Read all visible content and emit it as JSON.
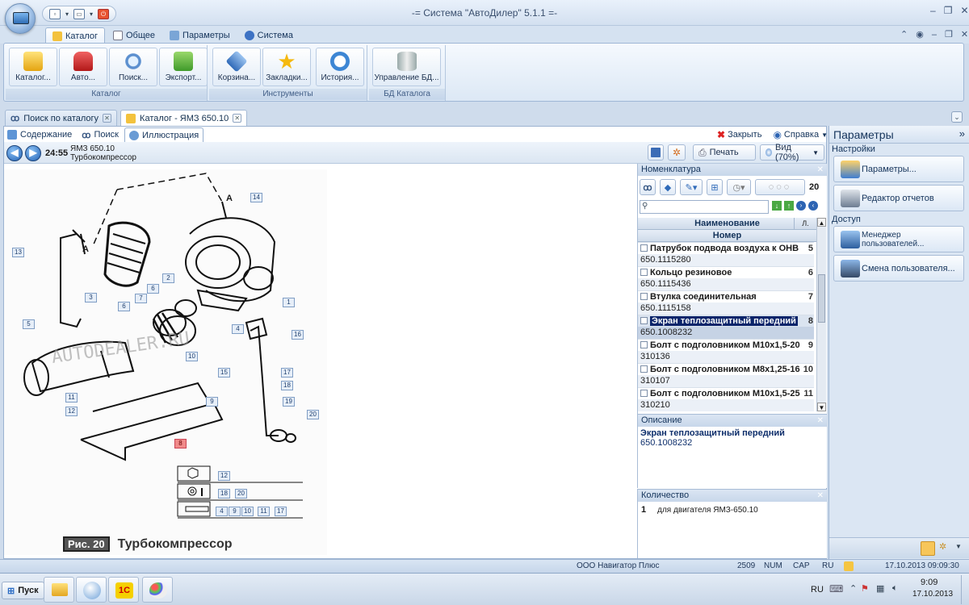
{
  "window": {
    "title": "-= Система \"АвтоДилер\" 5.1.1 =-"
  },
  "ribbon_tabs": [
    {
      "label": "Каталог",
      "active": true
    },
    {
      "label": "Общее",
      "active": false
    },
    {
      "label": "Параметры",
      "active": false
    },
    {
      "label": "Система",
      "active": false
    }
  ],
  "ribbon": {
    "groups": [
      {
        "label": "Каталог",
        "buttons": [
          "Каталог...",
          "Авто...",
          "Поиск...",
          "Экспорт..."
        ]
      },
      {
        "label": "Инструменты",
        "buttons": [
          "Корзина...",
          "Закладки...",
          "История..."
        ]
      },
      {
        "label": "БД Каталога",
        "buttons": [
          "Управление БД..."
        ]
      }
    ]
  },
  "doc_tabs": [
    {
      "label": "Поиск по каталогу",
      "active": false
    },
    {
      "label": "Каталог - ЯМЗ  650.10",
      "active": true
    }
  ],
  "sub_tabs": [
    {
      "label": "Содержание",
      "active": false
    },
    {
      "label": "Поиск",
      "active": false
    },
    {
      "label": "Иллюстрация",
      "active": true
    }
  ],
  "toolbar": {
    "close_label": "Закрыть",
    "help_label": "Справка",
    "time": "24:55",
    "model": "ЯМЗ  650.10",
    "subtitle": "Турбокомпрессор",
    "print_label": "Печать",
    "view_label": "Вид (70%)"
  },
  "illustration": {
    "watermark": "AUTODEALER.RU",
    "caption_prefix": "Рис. 20",
    "caption": "Турбокомпрессор",
    "callouts": [
      "14",
      "A",
      "13",
      "A",
      "3",
      "2",
      "6",
      "6",
      "7",
      "1",
      "5",
      "4",
      "16",
      "10",
      "15",
      "17",
      "18",
      "11",
      "12",
      "9",
      "19",
      "20",
      "8"
    ],
    "legend": {
      "row1": [
        "12"
      ],
      "row2": [
        "18",
        "20"
      ],
      "row3": [
        "4",
        "9",
        "10",
        "11",
        "17"
      ]
    }
  },
  "nomenclature": {
    "title": "Номенклатура",
    "toolbar_extra": "20",
    "search_placeholder": "",
    "col_name": "Наименование",
    "col_num": "Номер",
    "col_qty": "Л.",
    "rows": [
      {
        "name": "Патрубок подвода воздуха к ОНВ",
        "number": "650.1115280",
        "qty": "5",
        "selected": false
      },
      {
        "name": "Кольцо резиновое",
        "number": "650.1115436",
        "qty": "6",
        "selected": false
      },
      {
        "name": "Втулка соединительная",
        "number": "650.1115158",
        "qty": "7",
        "selected": false
      },
      {
        "name": "Экран теплозащитный передний",
        "number": "650.1008232",
        "qty": "8",
        "selected": true
      },
      {
        "name": "Болт с подголовником М10х1,5-20",
        "number": "310136",
        "qty": "9",
        "selected": false
      },
      {
        "name": "Болт с подголовником М8х1,25-16",
        "number": "310107",
        "qty": "10",
        "selected": false
      },
      {
        "name": "Болт с подголовником М10х1,5-25",
        "number": "310210",
        "qty": "11",
        "selected": false
      }
    ]
  },
  "description": {
    "title": "Описание",
    "name": "Экран теплозащитный передний",
    "number": "650.1008232"
  },
  "quantity": {
    "title": "Количество",
    "value": "1",
    "text": "для двигателя ЯМЗ-650.10"
  },
  "params_panel": {
    "title": "Параметры",
    "section1": "Настройки",
    "btn1": "Параметры...",
    "btn2": "Редактор отчетов",
    "section2": "Доступ",
    "btn3": "Менеджер пользователей...",
    "btn4": "Смена пользователя..."
  },
  "statusbar": {
    "company": "ООО Навигатор Плюс",
    "code": "2509",
    "num": "NUM",
    "cap": "CAP",
    "lang": "RU",
    "datetime": "17.10.2013 09:09:30"
  },
  "taskbar": {
    "start": "Пуск",
    "lang": "RU",
    "time": "9:09",
    "date": "17.10.2013"
  }
}
